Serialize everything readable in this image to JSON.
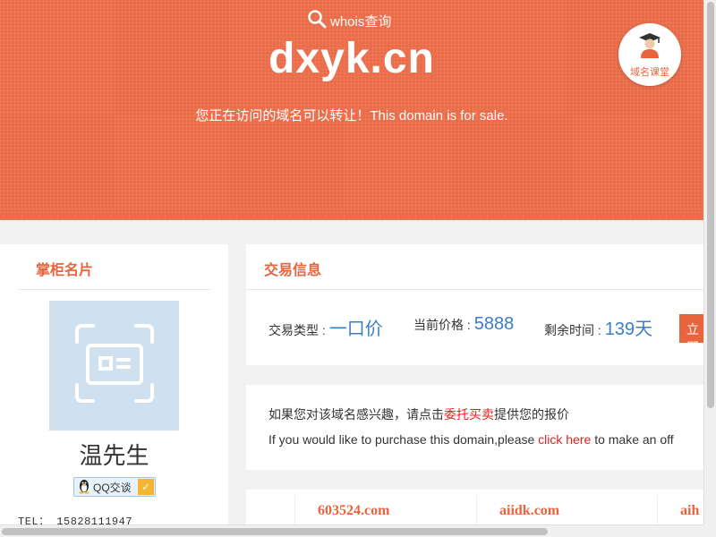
{
  "header": {
    "whois_label": "whois查询",
    "domain": "dxyk.cn",
    "sale_text": "您正在访问的域名可以转让！This domain is for sale.",
    "class_badge_label": "域名课堂"
  },
  "seller_card": {
    "title": "掌柜名片",
    "name": "温先生",
    "qq_label": "QQ交谈",
    "tel": "TEL： 15828111947"
  },
  "trade_info": {
    "title": "交易信息",
    "type_label": "交易类型 :",
    "type_value": "一口价",
    "price_label": "当前价格 :",
    "price_value": "5888",
    "remaining_label": "剩余时间 :",
    "remaining_value": "139天",
    "buy_button": "立即"
  },
  "offer": {
    "line1_prefix": "如果您对该域名感兴趣，请点击",
    "line1_link": "委托买卖",
    "line1_suffix": "提供您的报价",
    "line2_prefix": "If you would like to purchase this domain,please ",
    "line2_link": "click here",
    "line2_suffix": " to make an off"
  },
  "other_domains": [
    "603524.com",
    "aiidk.com",
    "aih"
  ],
  "colors": {
    "brand": "#ea6c48",
    "accent_text": "#e8643d",
    "value_blue": "#3c7dc4",
    "link_red": "#e02020"
  }
}
